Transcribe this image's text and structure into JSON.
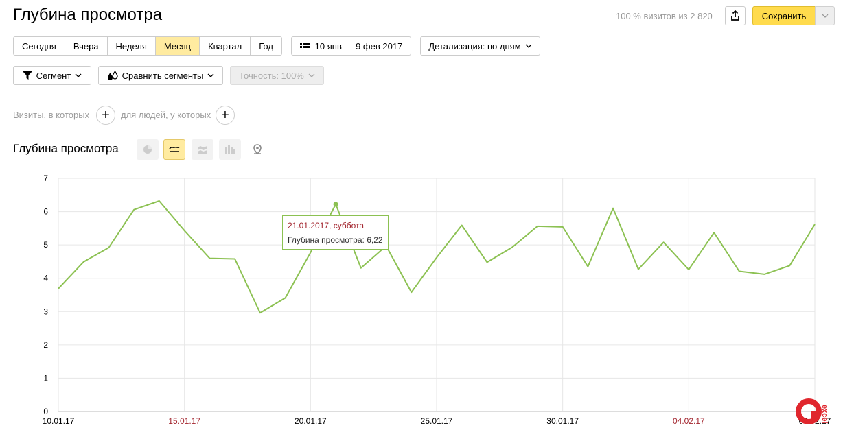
{
  "header": {
    "title": "Глубина просмотра",
    "visits_info": "100 % визитов из 2 820",
    "save_label": "Сохранить"
  },
  "periods": [
    {
      "label": "Сегодня",
      "active": false
    },
    {
      "label": "Вчера",
      "active": false
    },
    {
      "label": "Неделя",
      "active": false
    },
    {
      "label": "Месяц",
      "active": true
    },
    {
      "label": "Квартал",
      "active": false
    },
    {
      "label": "Год",
      "active": false
    }
  ],
  "toolbar": {
    "date_range": "10 янв — 9 фев 2017",
    "detail": "Детализация: по дням",
    "segment": "Сегмент",
    "compare": "Сравнить сегменты",
    "accuracy": "Точность: 100%"
  },
  "conditions": {
    "visits_label": "Визиты, в которых",
    "people_label": "для людей, у которых"
  },
  "chart_section": {
    "title": "Глубина просмотра",
    "chart_types": [
      "pie-chart-icon",
      "line-chart-icon",
      "area-chart-icon",
      "bar-chart-icon",
      "map-icon"
    ],
    "active_type": "line-chart-icon"
  },
  "tooltip": {
    "date": "21.01.2017, суббота",
    "value": "Глубина просмотра: 6,22"
  },
  "colors": {
    "line": "#8cc152",
    "weekend_label": "#a3252e",
    "accent": "#ffdb4d",
    "active_period": "#ffeba0"
  },
  "chart_data": {
    "type": "line",
    "title": "",
    "ylabel": "",
    "xlabel": "",
    "ylim": [
      0,
      7
    ],
    "yticks": [
      0,
      1,
      2,
      3,
      4,
      5,
      6,
      7
    ],
    "xtick_labels": [
      {
        "label": "10.01.17",
        "index": 0,
        "weekend": false
      },
      {
        "label": "15.01.17",
        "index": 5,
        "weekend": true
      },
      {
        "label": "20.01.17",
        "index": 10,
        "weekend": false
      },
      {
        "label": "25.01.17",
        "index": 15,
        "weekend": false
      },
      {
        "label": "30.01.17",
        "index": 20,
        "weekend": false
      },
      {
        "label": "04.02.17",
        "index": 25,
        "weekend": true
      },
      {
        "label": "09.02.17",
        "index": 30,
        "weekend": false
      }
    ],
    "series": [
      {
        "values": [
          3.69,
          4.49,
          4.92,
          6.06,
          6.32,
          5.43,
          4.6,
          4.58,
          2.96,
          3.41,
          4.77,
          6.22,
          4.31,
          4.97,
          3.58,
          4.62,
          5.59,
          4.48,
          4.93,
          5.56,
          5.54,
          4.35,
          6.1,
          4.27,
          5.08,
          4.26,
          5.37,
          4.21,
          4.12,
          4.38,
          5.62
        ]
      }
    ],
    "highlight_index": 11,
    "grid": true
  }
}
